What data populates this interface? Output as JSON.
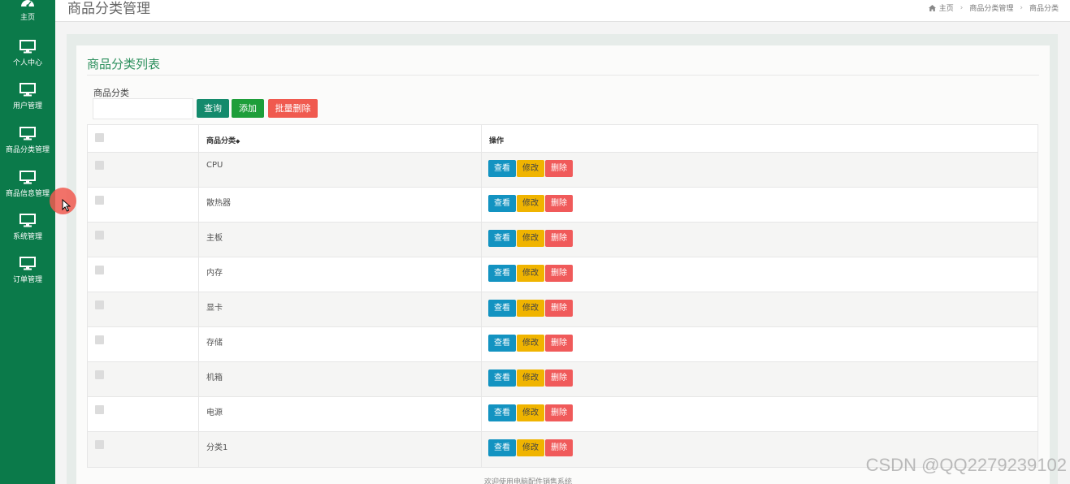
{
  "sidebar": {
    "items": [
      {
        "label": "主页",
        "icon": "dashboard-icon"
      },
      {
        "label": "个人中心",
        "icon": "monitor-icon"
      },
      {
        "label": "用户管理",
        "icon": "monitor-icon"
      },
      {
        "label": "商品分类管理",
        "icon": "monitor-icon"
      },
      {
        "label": "商品信息管理",
        "icon": "monitor-icon"
      },
      {
        "label": "系统管理",
        "icon": "monitor-icon"
      },
      {
        "label": "订单管理",
        "icon": "monitor-icon"
      }
    ]
  },
  "header": {
    "title": "商品分类管理",
    "breadcrumb": [
      "主页",
      "商品分类管理",
      "商品分类"
    ]
  },
  "card": {
    "title": "商品分类列表",
    "filter_label": "商品分类",
    "filter_placeholder": "",
    "buttons": {
      "query": "查询",
      "add": "添加",
      "batch_delete": "批量删除"
    }
  },
  "table": {
    "headers": {
      "category": "商品分类",
      "sort_icon": "◆",
      "actions": "操作"
    },
    "action_labels": {
      "view": "查看",
      "edit": "修改",
      "delete": "删除"
    },
    "rows": [
      "CPU",
      "散热器",
      "主板",
      "内存",
      "显卡",
      "存储",
      "机箱",
      "电源",
      "分类1"
    ]
  },
  "footer": {
    "text": "欢迎使用电脑配件销售系统"
  },
  "watermark": "CSDN @QQ2279239102",
  "colors": {
    "sidebar": "#0b7a4a",
    "accent": "#2b8f5c",
    "view": "#1393c1",
    "edit": "#f0b400",
    "delete": "#f05a5a"
  }
}
